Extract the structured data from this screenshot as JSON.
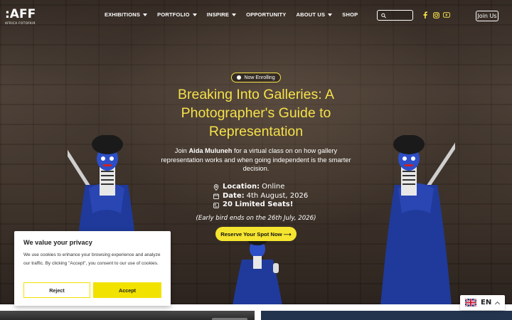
{
  "nav": {
    "logo_main": ":AFF",
    "logo_sub": "AFRICA FOTOFAIR",
    "menu": [
      {
        "label": "EXHIBITIONS",
        "has_dropdown": true
      },
      {
        "label": "PORTFOLIO",
        "has_dropdown": true
      },
      {
        "label": "INSPIRE",
        "has_dropdown": true
      },
      {
        "label": "OPPORTUNITY",
        "has_dropdown": false
      },
      {
        "label": "ABOUT US",
        "has_dropdown": true
      },
      {
        "label": "SHOP",
        "has_dropdown": false
      }
    ],
    "search_placeholder": "",
    "social_icons": [
      "facebook-icon",
      "instagram-icon",
      "youtube-icon"
    ],
    "join_label": "Join Us"
  },
  "hero": {
    "badge": "Now Enrolling",
    "title": "Breaking Into Galleries: A Photographer's Guide to Representation",
    "desc_prefix": "Join ",
    "desc_name": "Aida Muluneh",
    "desc_suffix": " for a virtual class on on how gallery representation works and when going independent is the smarter decision.",
    "details": [
      {
        "icon": "location-pin-icon",
        "label": "Location:",
        "value": "Online"
      },
      {
        "icon": "calendar-icon",
        "label": "Date:",
        "value": "4th August, 2026"
      },
      {
        "icon": "seats-icon",
        "label": "20 Limited Seats!",
        "value": ""
      }
    ],
    "early_bird": "(Early bird ends on the 26th July, 2026)",
    "cta_label": "Reserve Your Spot Now ⟶"
  },
  "cookie": {
    "title": "We value your privacy",
    "text": "We use cookies to enhance your browsing experience and analyze our traffic. By clicking \"Accept\", you consent to our use of cookies.",
    "reject_label": "Reject",
    "accept_label": "Accept"
  },
  "language": {
    "code": "EN"
  },
  "colors": {
    "accent": "#f5e14a",
    "button_yellow": "#f2e200",
    "figure_blue": "#1f3a9a"
  }
}
